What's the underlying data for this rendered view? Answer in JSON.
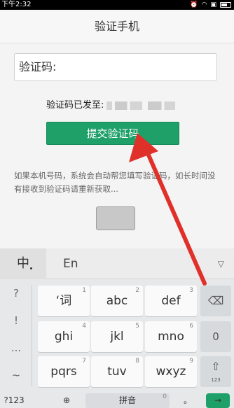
{
  "status_bar": {
    "time": "下午2:32"
  },
  "header": {
    "title": "验证手机"
  },
  "form": {
    "code_placeholder": "验证码:",
    "sent_label": "验证码已发至:",
    "submit_label": "提交验证码",
    "hint_text": "如果本机号码，系统会自动帮您填写验证码，如长时间没有接收到验证码请重新获取..."
  },
  "keyboard": {
    "lang_cn": "中",
    "lang_en": "En",
    "collapse": "▽",
    "left_column": [
      "?",
      "!",
      "...",
      "~"
    ],
    "keys": [
      {
        "label": "‘词",
        "num": "1"
      },
      {
        "label": "abc",
        "num": "2"
      },
      {
        "label": "def",
        "num": "3"
      },
      {
        "label": "ghi",
        "num": "4"
      },
      {
        "label": "jkl",
        "num": "5"
      },
      {
        "label": "mno",
        "num": "6"
      },
      {
        "label": "pqrs",
        "num": "7"
      },
      {
        "label": "tuv",
        "num": "8"
      },
      {
        "label": "wxyz",
        "num": "9"
      }
    ],
    "zero": "0",
    "shift_sub": "123",
    "bottom": {
      "symbols": "?123",
      "space_label": "拼音",
      "space_num": "0",
      "period": "。"
    }
  },
  "colors": {
    "accent": "#1ea068",
    "annotation_arrow": "#e0302a"
  },
  "icons": [
    "wifi-icon",
    "alarm-icon",
    "battery-icon",
    "backspace-icon",
    "shift-icon",
    "globe-icon",
    "enter-icon"
  ]
}
